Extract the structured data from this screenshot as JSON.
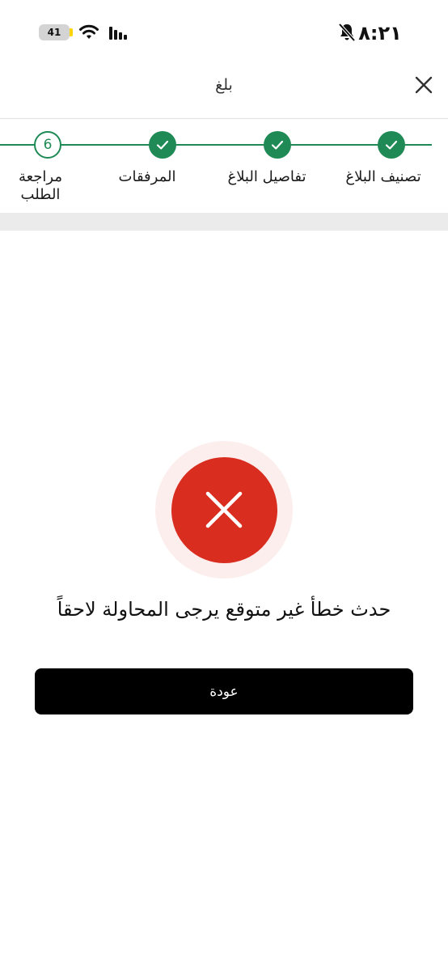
{
  "status_bar": {
    "battery_level": "41",
    "time": "٨:٢١"
  },
  "header": {
    "title": "بلغ"
  },
  "stepper": {
    "steps": [
      {
        "label": "تصنيف البلاغ",
        "state": "done"
      },
      {
        "label": "تفاصيل البلاغ",
        "state": "done"
      },
      {
        "label": "المرفقات",
        "state": "done"
      },
      {
        "label": "مراجعة الطلب",
        "state": "current",
        "number": "6"
      }
    ]
  },
  "error": {
    "message": "حدث خطأ غير متوقع يرجى المحاولة لاحقاً"
  },
  "actions": {
    "back_label": "عودة"
  },
  "colors": {
    "accent_green": "#1f8a55",
    "error_red": "#d92d20",
    "error_halo": "#fdeeee",
    "button_bg": "#000000"
  }
}
